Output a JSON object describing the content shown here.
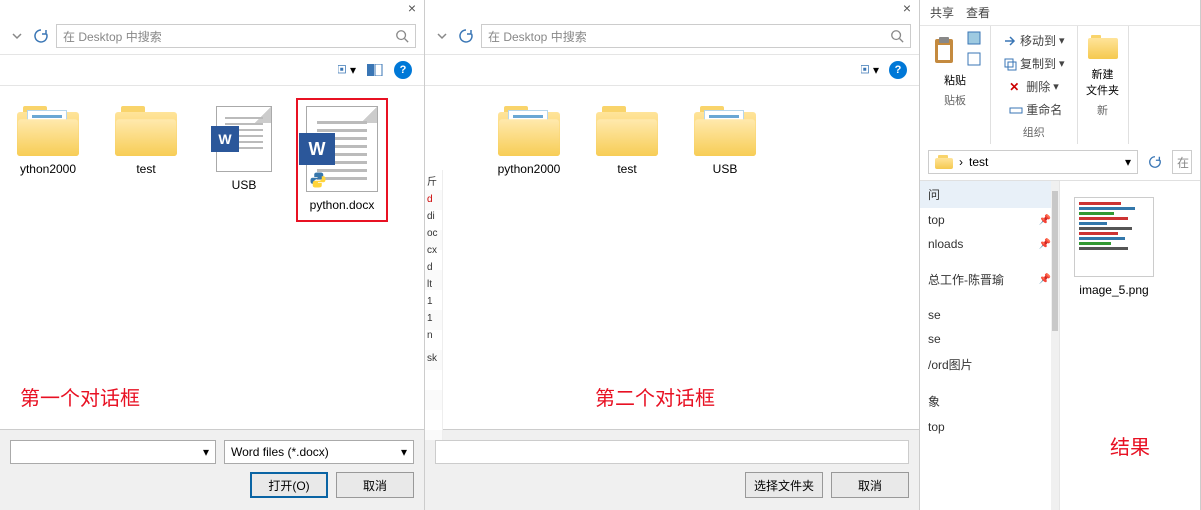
{
  "search_placeholder": "在 Desktop 中搜索",
  "dialog1": {
    "caption": "第一个对话框",
    "items": [
      {
        "type": "folder",
        "name": "ython2000"
      },
      {
        "type": "folder-plain",
        "name": "test"
      },
      {
        "type": "docx",
        "name": "USB"
      },
      {
        "type": "docx-big",
        "name": "python.docx",
        "selected": true
      }
    ],
    "filter": "Word files (*.docx)",
    "open": "打开(O)",
    "cancel": "取消"
  },
  "dialog2": {
    "caption": "第二个对话框",
    "items": [
      {
        "type": "folder",
        "name": "python2000"
      },
      {
        "type": "folder-plain",
        "name": "test"
      },
      {
        "type": "folder",
        "name": "USB"
      }
    ],
    "select": "选择文件夹",
    "cancel": "取消"
  },
  "pane3": {
    "tabs": [
      "共享",
      "查看"
    ],
    "paste": "粘贴",
    "move": "移动到",
    "copy": "复制到",
    "delete": "删除",
    "rename": "重命名",
    "newfolder": "新建\n文件夹",
    "grp_clip": "贴板",
    "grp_org": "组织",
    "grp_new": "新",
    "breadcrumb": "test",
    "search_short": "在",
    "sidebar": [
      {
        "t": "问",
        "hd": true
      },
      {
        "t": "top",
        "pin": true
      },
      {
        "t": "nloads",
        "pin": true
      },
      {
        "t": ""
      },
      {
        "t": "总工作-陈晋瑜",
        "pin": true
      },
      {
        "t": ""
      },
      {
        "t": "se"
      },
      {
        "t": "se"
      },
      {
        "t": "/ord图片"
      },
      {
        "t": ""
      },
      {
        "t": "象"
      },
      {
        "t": "top"
      }
    ],
    "file": "image_5.png",
    "result": "结果"
  }
}
